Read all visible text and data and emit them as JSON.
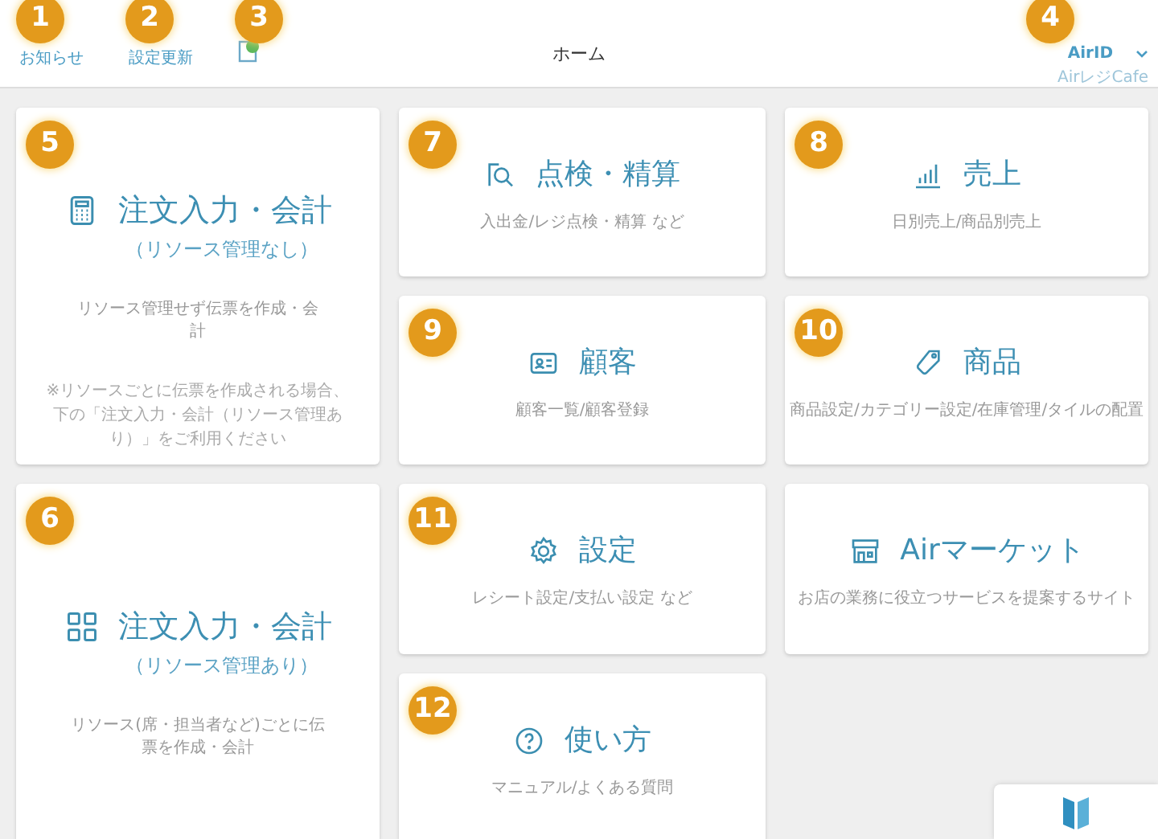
{
  "header": {
    "title": "ホーム",
    "left_items": [
      {
        "kind": "text",
        "label": "お知らせ",
        "marker": "1"
      },
      {
        "kind": "text",
        "label": "設定更新",
        "marker": "2"
      },
      {
        "kind": "icon",
        "marker": "3"
      }
    ],
    "account": {
      "label": "AirID",
      "sublabel": "AirレジCafe",
      "marker": "4"
    }
  },
  "tiles": [
    {
      "kind": "large",
      "title": "注文入力・会計",
      "subtitle": "（リソース管理なし）",
      "description": "リソース管理せず伝票を作成・会計",
      "note": "※リソースごとに伝票を作成される場合、下の「注文入力・会計（リソース管理あり）」をご利用ください",
      "marker": "5"
    },
    {
      "kind": "large",
      "title": "注文入力・会計",
      "subtitle": "（リソース管理あり）",
      "description": "リソース(席・担当者など)ごとに伝票を作成・会計",
      "marker": "6"
    },
    {
      "kind": "small",
      "title": "点検・精算",
      "description": "入出金/レジ点検・精算 など",
      "marker": "7"
    },
    {
      "kind": "small",
      "title": "売上",
      "description": "日別売上/商品別売上",
      "marker": "8"
    },
    {
      "kind": "small",
      "title": "顧客",
      "description": "顧客一覧/顧客登録",
      "marker": "9"
    },
    {
      "kind": "small",
      "title": "商品",
      "description": "商品設定/カテゴリー設定/在庫管理/タイルの配置",
      "marker": "10"
    },
    {
      "kind": "small",
      "title": "設定",
      "description": "レシート設定/支払い設定 など",
      "marker": "11"
    },
    {
      "kind": "small",
      "title": "Airマーケット",
      "description": "お店の業務に役立つサービスを提案するサイト"
    },
    {
      "kind": "small",
      "title": "使い方",
      "description": "マニュアル/よくある質問",
      "marker": "12"
    }
  ]
}
